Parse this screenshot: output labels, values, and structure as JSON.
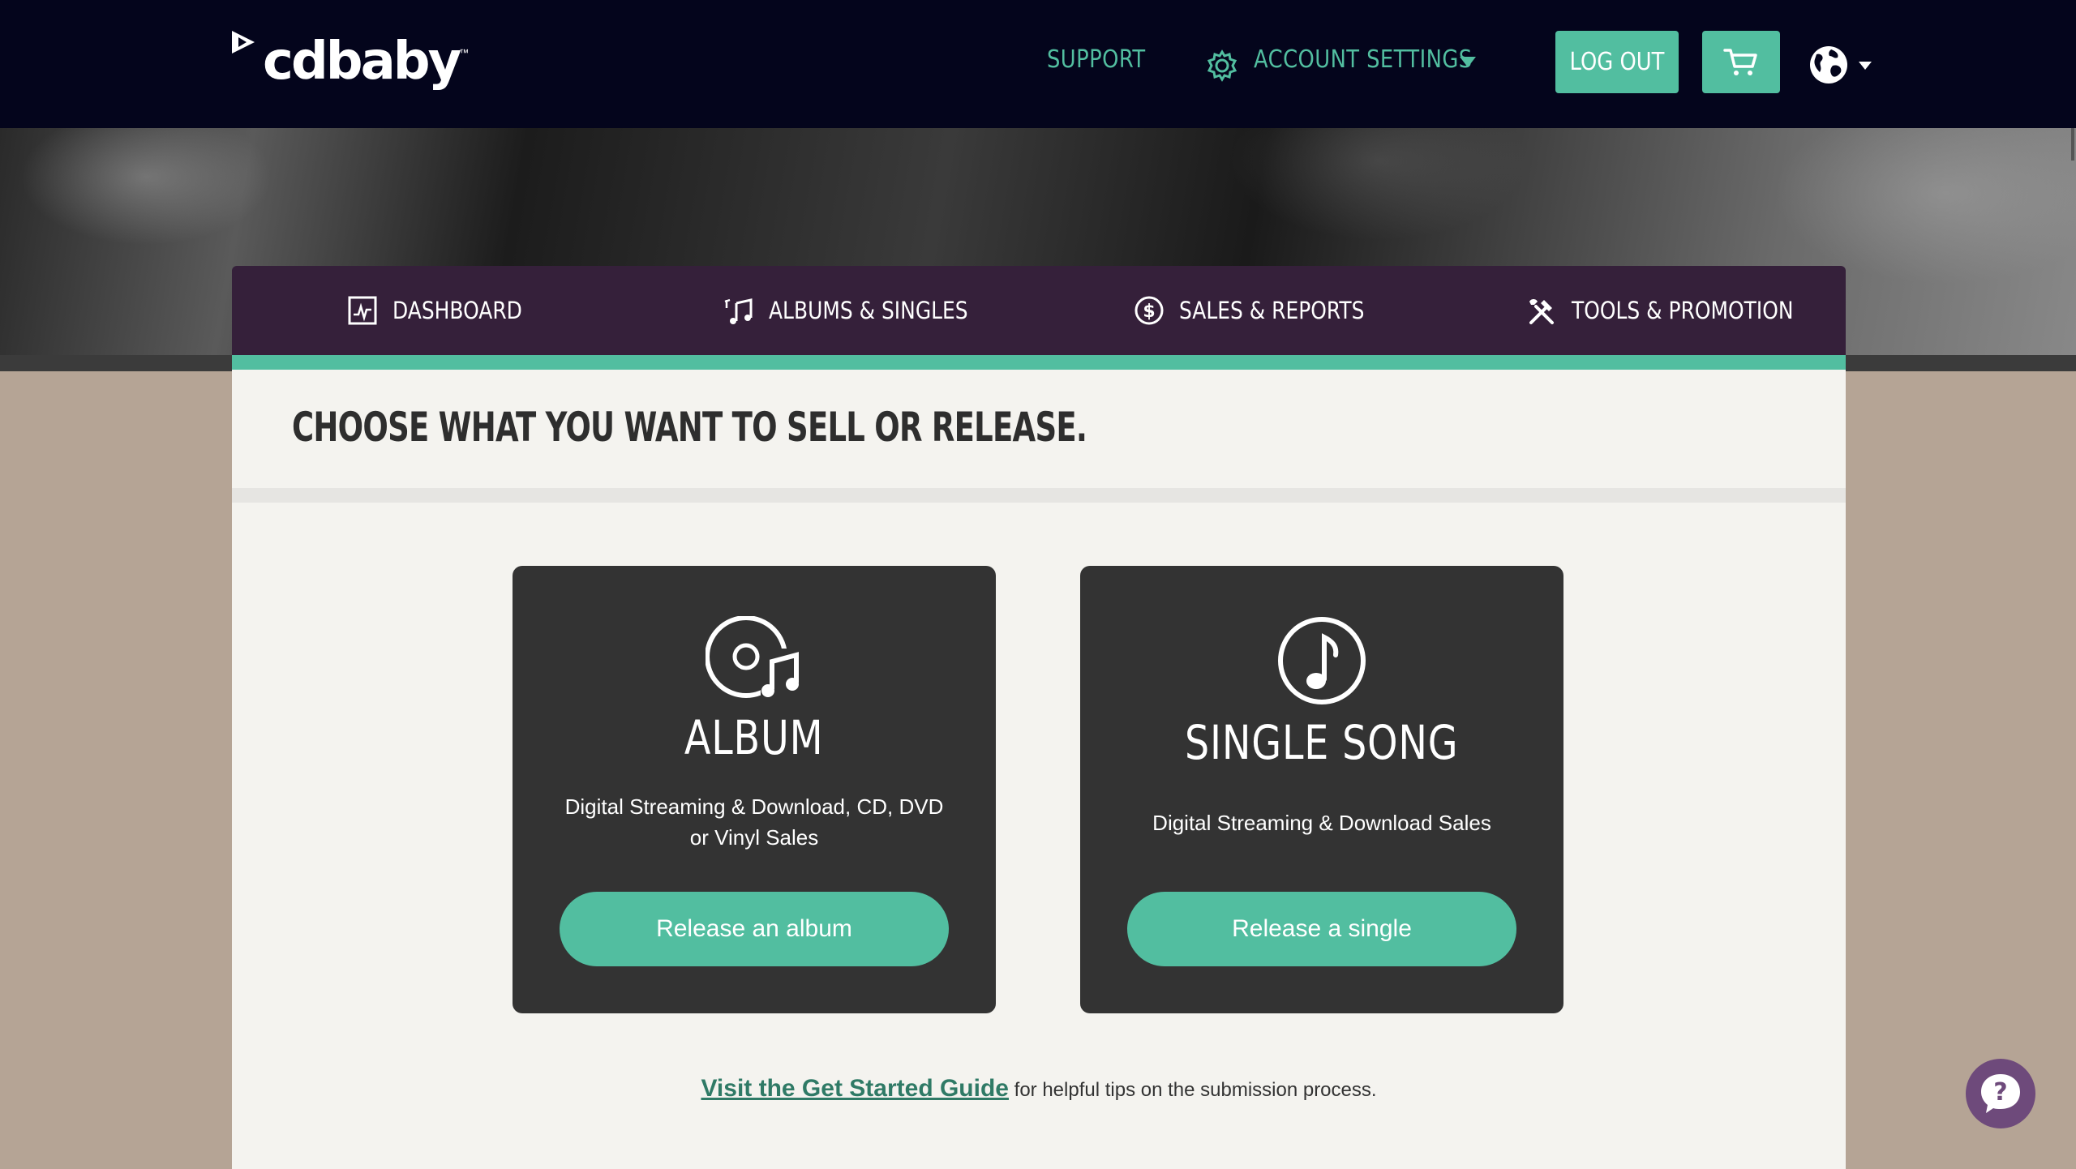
{
  "header": {
    "logo_text": "cdbaby",
    "logo_tm": "™",
    "support": "SUPPORT",
    "account_settings": "ACCOUNT SETTINGS",
    "logout": "LOG OUT",
    "cart_icon": "cart-icon",
    "globe_icon": "globe-icon"
  },
  "tabs": [
    {
      "label": "DASHBOARD",
      "icon": "dashboard-icon"
    },
    {
      "label": "ALBUMS & SINGLES",
      "icon": "music-note-icon"
    },
    {
      "label": "SALES & REPORTS",
      "icon": "dollar-icon"
    },
    {
      "label": "TOOLS & PROMOTION",
      "icon": "tools-icon"
    }
  ],
  "main": {
    "heading": "CHOOSE WHAT YOU WANT TO SELL OR RELEASE.",
    "cards": [
      {
        "title": "ALBUM",
        "description": "Digital Streaming & Download, CD, DVD or Vinyl Sales",
        "button": "Release an album",
        "icon": "album-icon"
      },
      {
        "title": "SINGLE SONG",
        "description": "Digital Streaming & Download Sales",
        "button": "Release a single",
        "icon": "single-note-icon"
      }
    ],
    "guide_link": "Visit the Get Started Guide",
    "guide_text": " for helpful tips on the submission process."
  },
  "colors": {
    "topbar": "#04051c",
    "accent": "#52bea0",
    "tabnav": "#35203a",
    "card": "#333333",
    "page_bg": "#b5a495",
    "panel": "#f4f3ef",
    "help": "#6e4a7b"
  }
}
